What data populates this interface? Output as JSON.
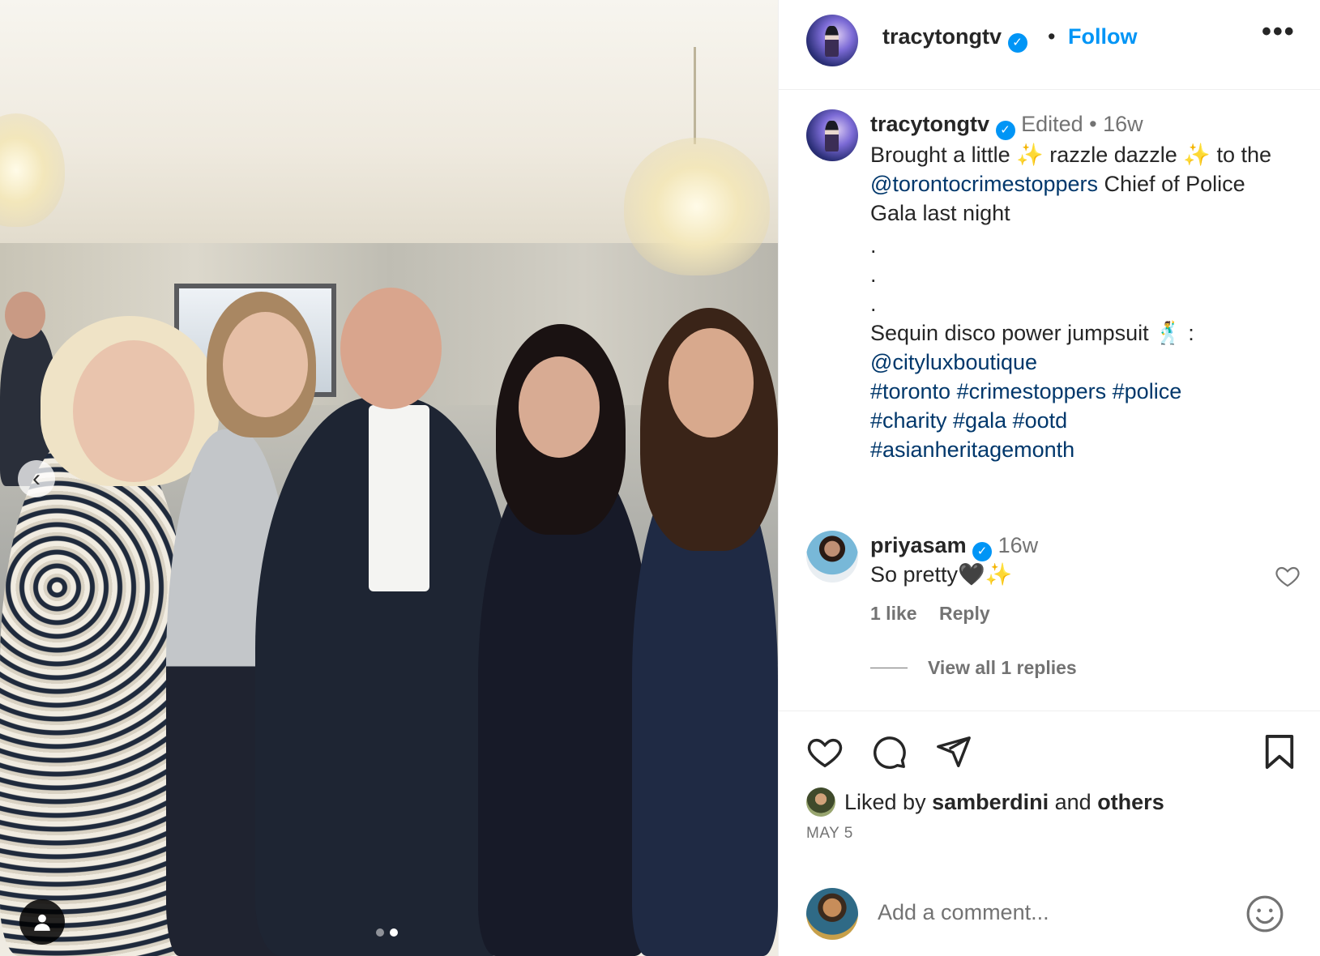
{
  "post": {
    "username": "tracytongtv",
    "verified_mark": "✓",
    "separator": "•",
    "follow_label": "Follow",
    "more_label": "•••"
  },
  "caption": {
    "username": "tracytongtv",
    "edited": "Edited",
    "dot": "•",
    "time": "16w",
    "line1_a": "Brought a little ",
    "sparkle": "✨",
    "line1_b": " razzle dazzle ",
    "line1_c": " to the ",
    "mention1": "@torontocrimestoppers",
    "line1_d": " Chief of Police Gala last night",
    "dots": [
      ".",
      ".",
      "."
    ],
    "line2": "Sequin disco power jumpsuit 🕺 :",
    "mention2": "@cityluxboutique",
    "hashtags_line1": "#toronto #crimestoppers #police",
    "hashtags_line2": "#charity #gala #ootd",
    "hashtags_line3": "#asianheritagemonth"
  },
  "comment": {
    "username": "priyasam",
    "verified_mark": "✓",
    "time": "16w",
    "text": "So pretty🖤✨",
    "likes": "1 like",
    "reply": "Reply",
    "view_replies": "View all 1 replies"
  },
  "actions": {
    "icons": [
      "heart-icon",
      "comment-icon",
      "share-icon",
      "bookmark-icon"
    ]
  },
  "likes": {
    "prefix": "Liked by ",
    "user": "samberdini",
    "middle": " and ",
    "others": "others"
  },
  "date": "MAY 5",
  "add_comment": {
    "placeholder": "Add a comment..."
  },
  "carousel": {
    "prev_arrow": "‹",
    "slide_count": 2,
    "active_slide": 2
  },
  "colors": {
    "accent": "#0095f6",
    "link": "#00376b",
    "muted": "#737373"
  }
}
